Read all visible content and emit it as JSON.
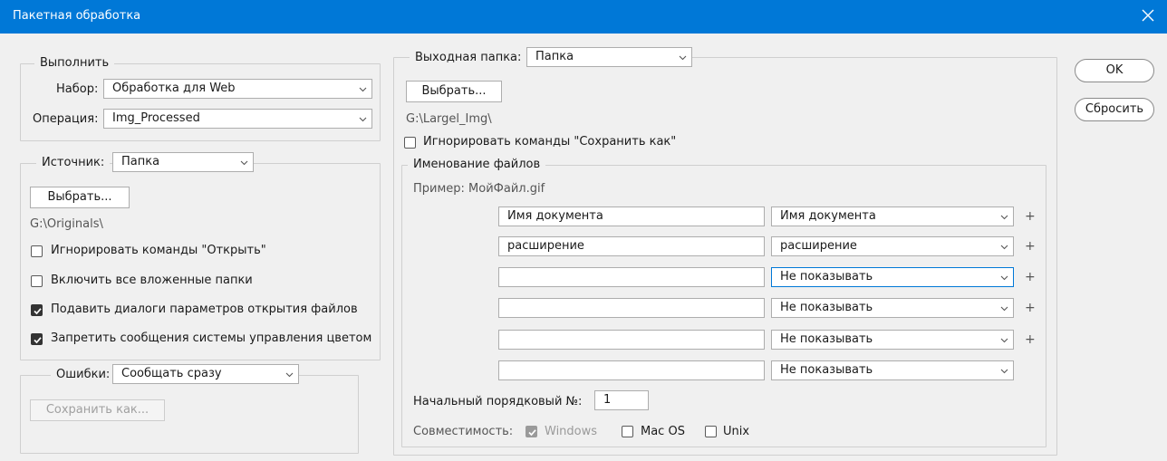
{
  "window": {
    "title": "Пакетная обработка"
  },
  "execute": {
    "legend": "Выполнить",
    "set_label": "Набор:",
    "set_value": "Обработка для Web",
    "operation_label": "Операция:",
    "operation_value": "Img_Processed"
  },
  "source": {
    "label": "Источник:",
    "value": "Папка",
    "choose_button": "Выбрать...",
    "path": "G:\\Originals\\",
    "options": [
      {
        "label": "Игнорировать команды \"Открыть\"",
        "checked": false
      },
      {
        "label": "Включить все вложенные папки",
        "checked": false
      },
      {
        "label": "Подавить диалоги параметров открытия файлов",
        "checked": true
      },
      {
        "label": "Запретить сообщения системы управления цветом",
        "checked": true
      }
    ]
  },
  "errors": {
    "label": "Ошибки:",
    "value": "Сообщать сразу",
    "save_as_button": "Сохранить как..."
  },
  "output": {
    "label": "Выходная папка:",
    "value": "Папка",
    "choose_button": "Выбрать...",
    "path": "G:\\Largel_Img\\",
    "ignore_save_as": {
      "label": "Игнорировать команды \"Сохранить как\"",
      "checked": false
    }
  },
  "naming": {
    "legend": "Именование файлов",
    "example": "Пример: МойФайл.gif",
    "rows": [
      {
        "input": "Имя документа",
        "select": "Имя документа",
        "plus": "+"
      },
      {
        "input": "расширение",
        "select": "расширение",
        "plus": "+"
      },
      {
        "input": "",
        "select": "Не показывать",
        "plus": "+"
      },
      {
        "input": "",
        "select": "Не показывать",
        "plus": "+"
      },
      {
        "input": "",
        "select": "Не показывать",
        "plus": "+"
      },
      {
        "input": "",
        "select": "Не показывать",
        "plus": ""
      }
    ],
    "start_serial_label": "Начальный порядковый №:",
    "start_serial_value": "1",
    "compat_label": "Совместимость:",
    "compat": [
      {
        "label": "Windows",
        "checked": true,
        "disabled": true
      },
      {
        "label": "Mac OS",
        "checked": false,
        "disabled": false
      },
      {
        "label": "Unix",
        "checked": false,
        "disabled": false
      }
    ]
  },
  "buttons": {
    "ok": "OK",
    "reset": "Сбросить"
  },
  "colors": {
    "titlebar": "#0078d7",
    "focus_border": "#0078d7"
  }
}
